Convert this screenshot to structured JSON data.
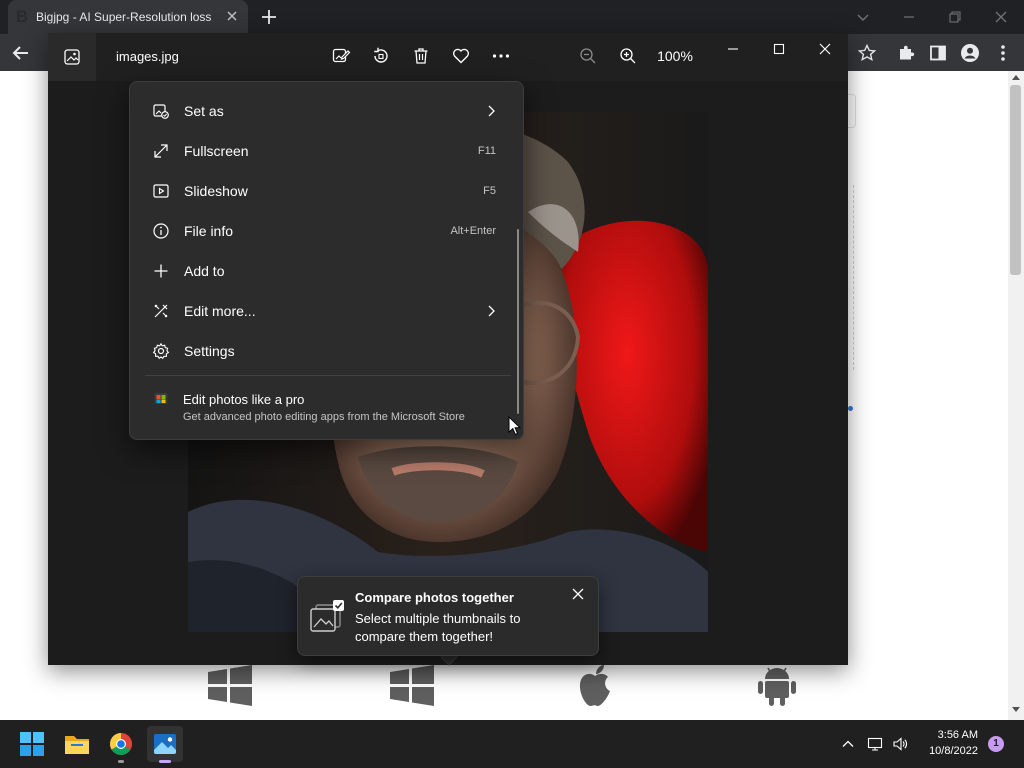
{
  "browser": {
    "tab": {
      "favicon_letter": "B",
      "title": "Bigjpg - AI Super-Resolution lossless image enlarging"
    },
    "toolbar_icons": [
      "back-icon",
      "star-icon",
      "puzzle-icon",
      "side-panel-icon",
      "profile-icon",
      "more-vertical-icon"
    ]
  },
  "photos_app": {
    "file_name": "images.jpg",
    "zoom_level": "100%",
    "toolbar_icons": [
      "edit-image-icon",
      "rotate-icon",
      "delete-icon",
      "favorite-icon",
      "more-icon",
      "zoom-out-icon",
      "zoom-in-icon"
    ],
    "context_menu": {
      "items": [
        {
          "label": "Set as",
          "shortcut": "",
          "icon": "set-as-icon",
          "has_submenu": true
        },
        {
          "label": "Fullscreen",
          "shortcut": "F11",
          "icon": "fullscreen-icon",
          "has_submenu": false
        },
        {
          "label": "Slideshow",
          "shortcut": "F5",
          "icon": "slideshow-icon",
          "has_submenu": false
        },
        {
          "label": "File info",
          "shortcut": "Alt+Enter",
          "icon": "info-icon",
          "has_submenu": false
        },
        {
          "label": "Add to",
          "shortcut": "",
          "icon": "plus-icon",
          "has_submenu": false
        },
        {
          "label": "Edit more...",
          "shortcut": "",
          "icon": "edit-tools-icon",
          "has_submenu": true
        },
        {
          "label": "Settings",
          "shortcut": "",
          "icon": "settings-icon",
          "has_submenu": false
        }
      ],
      "promo": {
        "title": "Edit photos like a pro",
        "subtitle": "Get advanced photo editing apps from the Microsoft Store",
        "icon": "microsoft-store-icon"
      }
    },
    "tip": {
      "title": "Compare photos together",
      "body": "Select multiple thumbnails to compare them together!",
      "icon": "compare-photos-icon"
    }
  },
  "webpage": {
    "os_logos": [
      "windows-logo",
      "windows-logo",
      "apple-logo",
      "android-logo"
    ]
  },
  "taskbar": {
    "apps": [
      "start-icon",
      "file-explorer-icon",
      "chrome-icon",
      "photos-icon"
    ],
    "tray_icons": [
      "chevron-up-icon",
      "network-icon",
      "volume-icon"
    ],
    "time": "3:56 AM",
    "date": "10/8/2022",
    "notification_count": "1"
  },
  "colors": {
    "accent": "#0078d4",
    "dark_bg": "#1c1c1c",
    "menu_bg": "#2c2c2c",
    "taskbar_bg": "#202020"
  }
}
